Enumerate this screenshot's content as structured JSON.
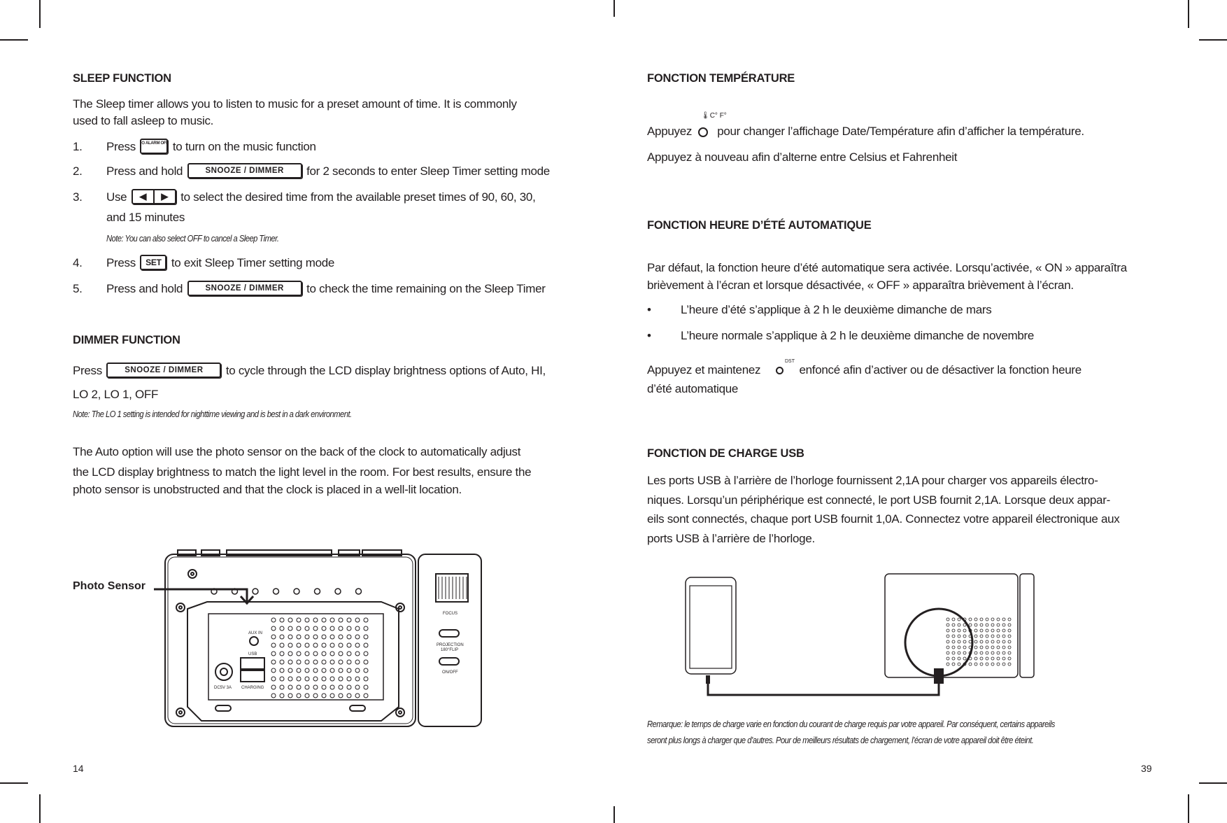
{
  "left_page": {
    "page_number": "14",
    "sleep": {
      "heading": "SLEEP FUNCTION",
      "intro_line1": "The Sleep timer allows you to listen to music for a preset amount of time.  It is commonly",
      "intro_line2": "used to fall asleep to music.",
      "steps": [
        {
          "num": "1.",
          "before": "Press",
          "button": "ALARM OFF",
          "after": "to turn on the music function"
        },
        {
          "num": "2.",
          "before": "Press and hold",
          "button": "SNOOZE / DIMMER",
          "after": "for 2 seconds to enter Sleep Timer setting mode"
        },
        {
          "num": "3.",
          "before": "Use",
          "button": "◀ ▶",
          "after": "to select the desired time from the available preset times of 90, 60, 30,",
          "after2": "and 15 minutes",
          "note": "Note: You can also select OFF to cancel a Sleep Timer."
        },
        {
          "num": "4.",
          "before": "Press",
          "button": "SET",
          "after": "to exit Sleep Timer setting mode"
        },
        {
          "num": "5.",
          "before": "Press and hold",
          "button": "SNOOZE / DIMMER",
          "after": "to check the time remaining on the Sleep Timer"
        }
      ]
    },
    "dimmer": {
      "heading": "DIMMER FUNCTION",
      "before": "Press",
      "button": "SNOOZE / DIMMER",
      "after": "to cycle through the LCD display brightness options of Auto, HI,",
      "line2": "LO 2, LO 1, OFF",
      "note": "Note: The LO 1 setting is intended for nighttime viewing and is best in a dark environment.",
      "auto_line1": "The Auto option will use the photo sensor on the back of the clock to automatically adjust",
      "auto_line2": "the LCD display brightness to match the light level in the room. For best results, ensure the",
      "auto_line3": "photo sensor is unobstructed and that the clock is placed in a well-lit location."
    },
    "diagram": {
      "callout": "Photo Sensor",
      "labels": {
        "aux_in": "AUX IN",
        "usb": "USB",
        "charging": "CHARGING",
        "dc": "DC5V 3A",
        "focus": "FOCUS",
        "projection": "PROJECTION",
        "flip": "180°FLIP",
        "onoff": "ON/OFF"
      }
    }
  },
  "right_page": {
    "page_number": "39",
    "temperature": {
      "heading": "FONCTION TEMPÉRATURE",
      "icon_label": "C° F°",
      "line1_before": "Appuyez",
      "line1_after": "pour changer l’affichage Date/Température afin d’afficher la température.",
      "line2": "Appuyez à nouveau afin d’alterne entre Celsius et Fahrenheit"
    },
    "dst": {
      "heading": "FONCTION HEURE D’ÉTÉ AUTOMATIQUE",
      "para_line1": "Par défaut, la fonction heure d’été automatique sera activée. Lorsqu’activée, « ON » apparaîtra",
      "para_line2": "brièvement à l’écran et lorsque désactivée, « OFF » apparaîtra brièvement à l’écran.",
      "bullets": [
        "L’heure d’été s’applique à 2 h le deuxième dimanche de mars",
        "L’heure normale s’applique à 2 h le deuxième dimanche de novembre"
      ],
      "bullet_char": "•",
      "hold_before": "Appuyez et maintenez",
      "icon_label": "DST",
      "hold_after": "enfoncé afin d’activer ou de désactiver la fonction heure",
      "hold_line2": "d’été automatique"
    },
    "usb": {
      "heading": "FONCTION DE CHARGE USB",
      "lines": [
        "Les ports USB à l’arrière de l’horloge fournissent 2,1A pour charger vos appareils électro-",
        "niques. Lorsqu’un périphérique est connecté, le port USB fournit 2,1A. Lorsque deux appar-",
        "eils sont connectés, chaque port USB fournit 1,0A. Connectez votre appareil électronique aux",
        "ports USB à l’arrière de l’horloge."
      ],
      "note_line1": "Remarque: le temps de charge varie en fonction du courant de charge requis par votre appareil. Par conséquent, certains appareils",
      "note_line2": "seront plus longs à charger que d’autres. Pour de meilleurs résultats de chargement, l’écran de votre appareil doit être éteint."
    }
  }
}
